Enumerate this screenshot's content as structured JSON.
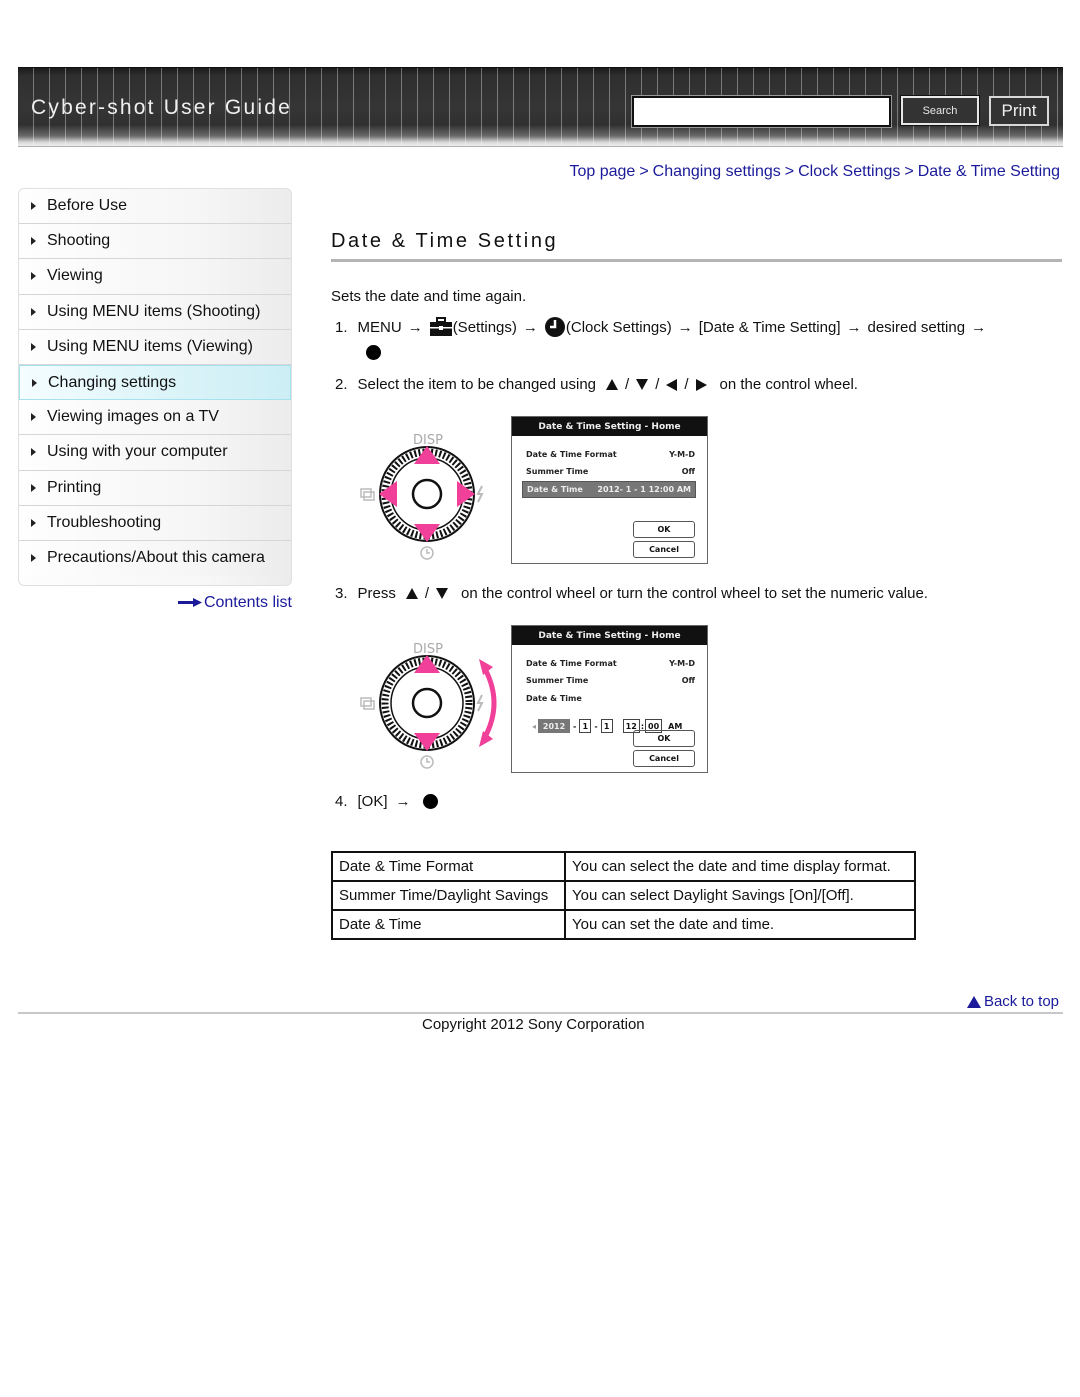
{
  "header": {
    "title": "Cyber-shot User Guide",
    "search_placeholder": "",
    "search_value": "",
    "search_label": "Search",
    "print_label": "Print"
  },
  "breadcrumb": [
    {
      "label": "Top page"
    },
    {
      "label": "Changing settings"
    },
    {
      "label": "Clock Settings"
    },
    {
      "label": "Date & Time Setting"
    }
  ],
  "breadcrumb_separator": ">",
  "sidebar": {
    "items": [
      {
        "label": "Before Use"
      },
      {
        "label": "Shooting"
      },
      {
        "label": "Viewing"
      },
      {
        "label": "Using MENU items (Shooting)"
      },
      {
        "label": "Using MENU items (Viewing)"
      },
      {
        "label": "Changing settings",
        "active": true
      },
      {
        "label": "Viewing images on a TV"
      },
      {
        "label": "Using with your computer"
      },
      {
        "label": "Printing"
      },
      {
        "label": "Troubleshooting"
      },
      {
        "label": "Precautions/About this camera"
      }
    ],
    "contents_link": "Contents list"
  },
  "main": {
    "title": "Date & Time Setting",
    "intro": "Sets the date and time again.",
    "steps": [
      {
        "num": "1.",
        "parts": [
          "MENU",
          "(Settings)",
          "(Clock Settings)",
          "[Date & Time Setting]",
          "desired setting"
        ],
        "icons": [
          "settings-toolbox-icon",
          "clock-icon",
          "center-button-icon"
        ]
      },
      {
        "num": "2.",
        "before": "Select the item to be changed using",
        "after": "on the control wheel.",
        "icons": [
          "up",
          "down",
          "left",
          "right"
        ]
      },
      {
        "num": "3.",
        "before": "Press",
        "after": "on the control wheel or turn the control wheel to set the numeric value.",
        "icons": [
          "up",
          "down"
        ]
      },
      {
        "num": "4.",
        "before": "[OK]"
      }
    ],
    "arrow_glyph": "→",
    "slash": "/",
    "screen1": {
      "header": "Date & Time Setting - Home",
      "rows": [
        {
          "label": "Date & Time Format",
          "value": "Y-M-D"
        },
        {
          "label": "Summer Time",
          "value": "Off"
        },
        {
          "label": "Date & Time",
          "value": "2012- 1 - 1 12:00 AM",
          "selected": true
        }
      ],
      "ok": "OK",
      "cancel": "Cancel"
    },
    "screen2": {
      "header": "Date & Time Setting - Home",
      "rows": [
        {
          "label": "Date & Time Format",
          "value": "Y-M-D"
        },
        {
          "label": "Summer Time",
          "value": "Off"
        },
        {
          "label": "Date & Time",
          "value": ""
        }
      ],
      "fields": {
        "year": "2012",
        "month": "1",
        "day": "1",
        "hour": "12",
        "minute": "00",
        "ampm": "AM"
      },
      "ok": "OK",
      "cancel": "Cancel"
    },
    "wheel": {
      "top_label": "DISP",
      "accent": "#f0409a"
    },
    "table": [
      {
        "key": "Date & Time Format",
        "value": "You can select the date and time display format."
      },
      {
        "key": "Summer Time/Daylight Savings",
        "value": "You can select Daylight Savings [On]/[Off]."
      },
      {
        "key": "Date & Time",
        "value": "You can set the date and time."
      }
    ]
  },
  "footer": {
    "back_to_top": "Back to top",
    "copyright": "Copyright 2012 Sony Corporation"
  },
  "colors": {
    "link": "#1a1a9a",
    "active_nav": "#d9f3f8",
    "header_bg": "#333333"
  }
}
